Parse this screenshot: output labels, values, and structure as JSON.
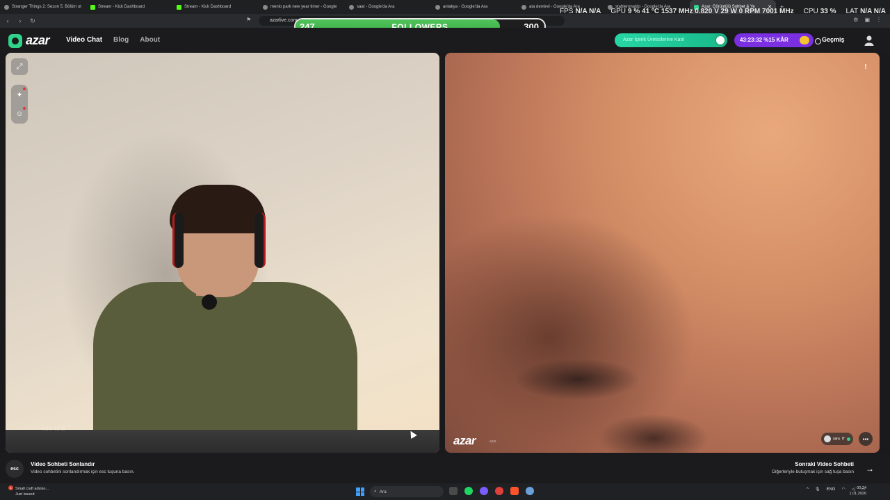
{
  "browser": {
    "tabs": [
      {
        "title": "Stranger Things 2: Sezon 5. Bölüm ot",
        "favicon": "generic"
      },
      {
        "title": "Stream - Kick Dashboard",
        "favicon": "kick"
      },
      {
        "title": "Stream - Kick Dashboard",
        "favicon": "kick"
      },
      {
        "title": "menlo park new year timer - Google",
        "favicon": "generic"
      },
      {
        "title": "saat - Google'da Ara",
        "favicon": "generic"
      },
      {
        "title": "antakya - Google'da Ara",
        "favicon": "generic"
      },
      {
        "title": "ata demirel - Google'da Ara",
        "favicon": "generic"
      },
      {
        "title": "stableronaldo - Google'da Ara",
        "favicon": "generic"
      },
      {
        "title": "Azar: Görüntülü Sohbet & Ye",
        "favicon": "azar",
        "active": true
      }
    ],
    "new_tab": "+",
    "address": "azarlive.com",
    "window_controls": [
      "—",
      "▢",
      "✕"
    ]
  },
  "hud": {
    "fps_label": "FPS",
    "fps_value": "N/A",
    "fps_value2": "N/A",
    "gpu_label": "GPU",
    "gpu_usage": "9 %",
    "gpu_temp": "41 °C",
    "gpu_clock": "1537 MHz",
    "gpu_volt": "0.820 V",
    "gpu_power": "29 W",
    "gpu_fan": "0 RPM",
    "gpu_mem": "7001 MHz",
    "cpu_label": "CPU",
    "cpu_usage": "33 %",
    "lat_label": "LAT",
    "lat_value": "N/A",
    "lat_value2": "N/A"
  },
  "followers": {
    "current": "247",
    "label": "FOLLOWERS",
    "goal": "300",
    "progress": 0.82
  },
  "app": {
    "logo": "azar",
    "nav": [
      {
        "label": "Video Chat",
        "active": true
      },
      {
        "label": "Blog",
        "active": false
      },
      {
        "label": "About",
        "active": false
      }
    ],
    "creator_cta": "Azar İçerik Üreticilerine Katıl",
    "timer": "43:23:32",
    "discount": "%15 KÂR",
    "history": "Geçmiş"
  },
  "left_panel": {
    "self_label": "kim knb"
  },
  "right_panel": {
    "logo": "azar",
    "partner_id": "azar",
    "partner_name": "sara",
    "partner_country": "IT"
  },
  "controls": {
    "esc_key": "esc",
    "end_title": "Video Sohbeti Sonlandır",
    "end_sub": "Video sohbetini sonlandırmak için esc tuşuna basın.",
    "next_title": "Sonraki Video Sohbeti",
    "next_sub": "Diğerleriyle buluşmak için sağ tuşa basın"
  },
  "taskbar": {
    "notification_count": "1",
    "weather_title": "Small craft adviso...",
    "weather_sub": "Just issued",
    "search_placeholder": "Ara",
    "lang": "ENG",
    "time": "00:24",
    "date": "1.01.2026"
  },
  "colors": {
    "brand": "#2fd38a",
    "followers_fill": "#4fc35a",
    "timer_pill": "#7a2fe0"
  }
}
